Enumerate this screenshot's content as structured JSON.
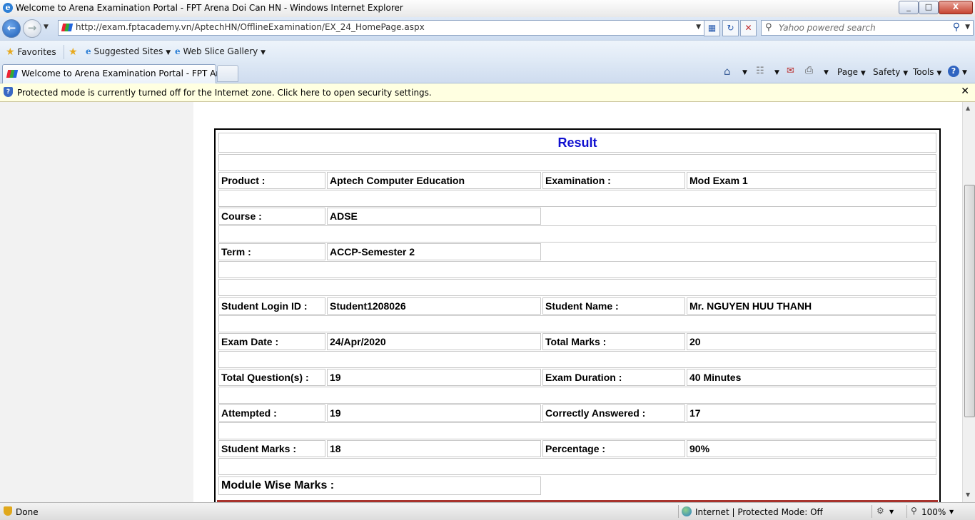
{
  "window": {
    "title": "Welcome to Arena Examination Portal - FPT Arena Doi Can HN - Windows Internet Explorer",
    "controls": [
      "_",
      "□",
      "X"
    ]
  },
  "address": {
    "url": "http://exam.fptacademy.vn/AptechHN/OfflineExamination/EX_24_HomePage.aspx",
    "search_placeholder": "Yahoo powered search"
  },
  "favorites": {
    "favorites_label": "Favorites",
    "suggested_label": "Suggested Sites",
    "webslice_label": "Web Slice Gallery"
  },
  "tabs": {
    "active_label": "Welcome to Arena Examination Portal - FPT Aren..."
  },
  "commands": {
    "page": "Page",
    "safety": "Safety",
    "tools": "Tools"
  },
  "infobar": {
    "message": "Protected mode is currently turned off for the Internet zone.  Click here to open security settings."
  },
  "result": {
    "title": "Result",
    "product_label": "Product :",
    "product_value": "Aptech Computer Education",
    "examination_label": "Examination :",
    "examination_value": "Mod Exam 1",
    "course_label": "Course :",
    "course_value": "ADSE",
    "term_label": "Term :",
    "term_value": "ACCP-Semester 2",
    "login_label": "Student Login ID :",
    "login_value": "Student1208026",
    "name_label": "Student Name :",
    "name_value": "Mr. NGUYEN HUU THANH",
    "examdate_label": "Exam Date :",
    "examdate_value": "24/Apr/2020",
    "totalmarks_label": "Total Marks :",
    "totalmarks_value": "20",
    "totalq_label": "Total Question(s) :",
    "totalq_value": "19",
    "duration_label": "Exam Duration :",
    "duration_value": "40 Minutes",
    "attempted_label": "Attempted :",
    "attempted_value": "19",
    "correct_label": "Correctly Answered :",
    "correct_value": "17",
    "marks_label": "Student Marks :",
    "marks_value": "18",
    "percentage_label": "Percentage :",
    "percentage_value": "90%",
    "module_label": "Module Wise Marks :"
  },
  "status": {
    "left": "Done",
    "zone": "Internet | Protected Mode: Off",
    "zoom": "100%"
  }
}
